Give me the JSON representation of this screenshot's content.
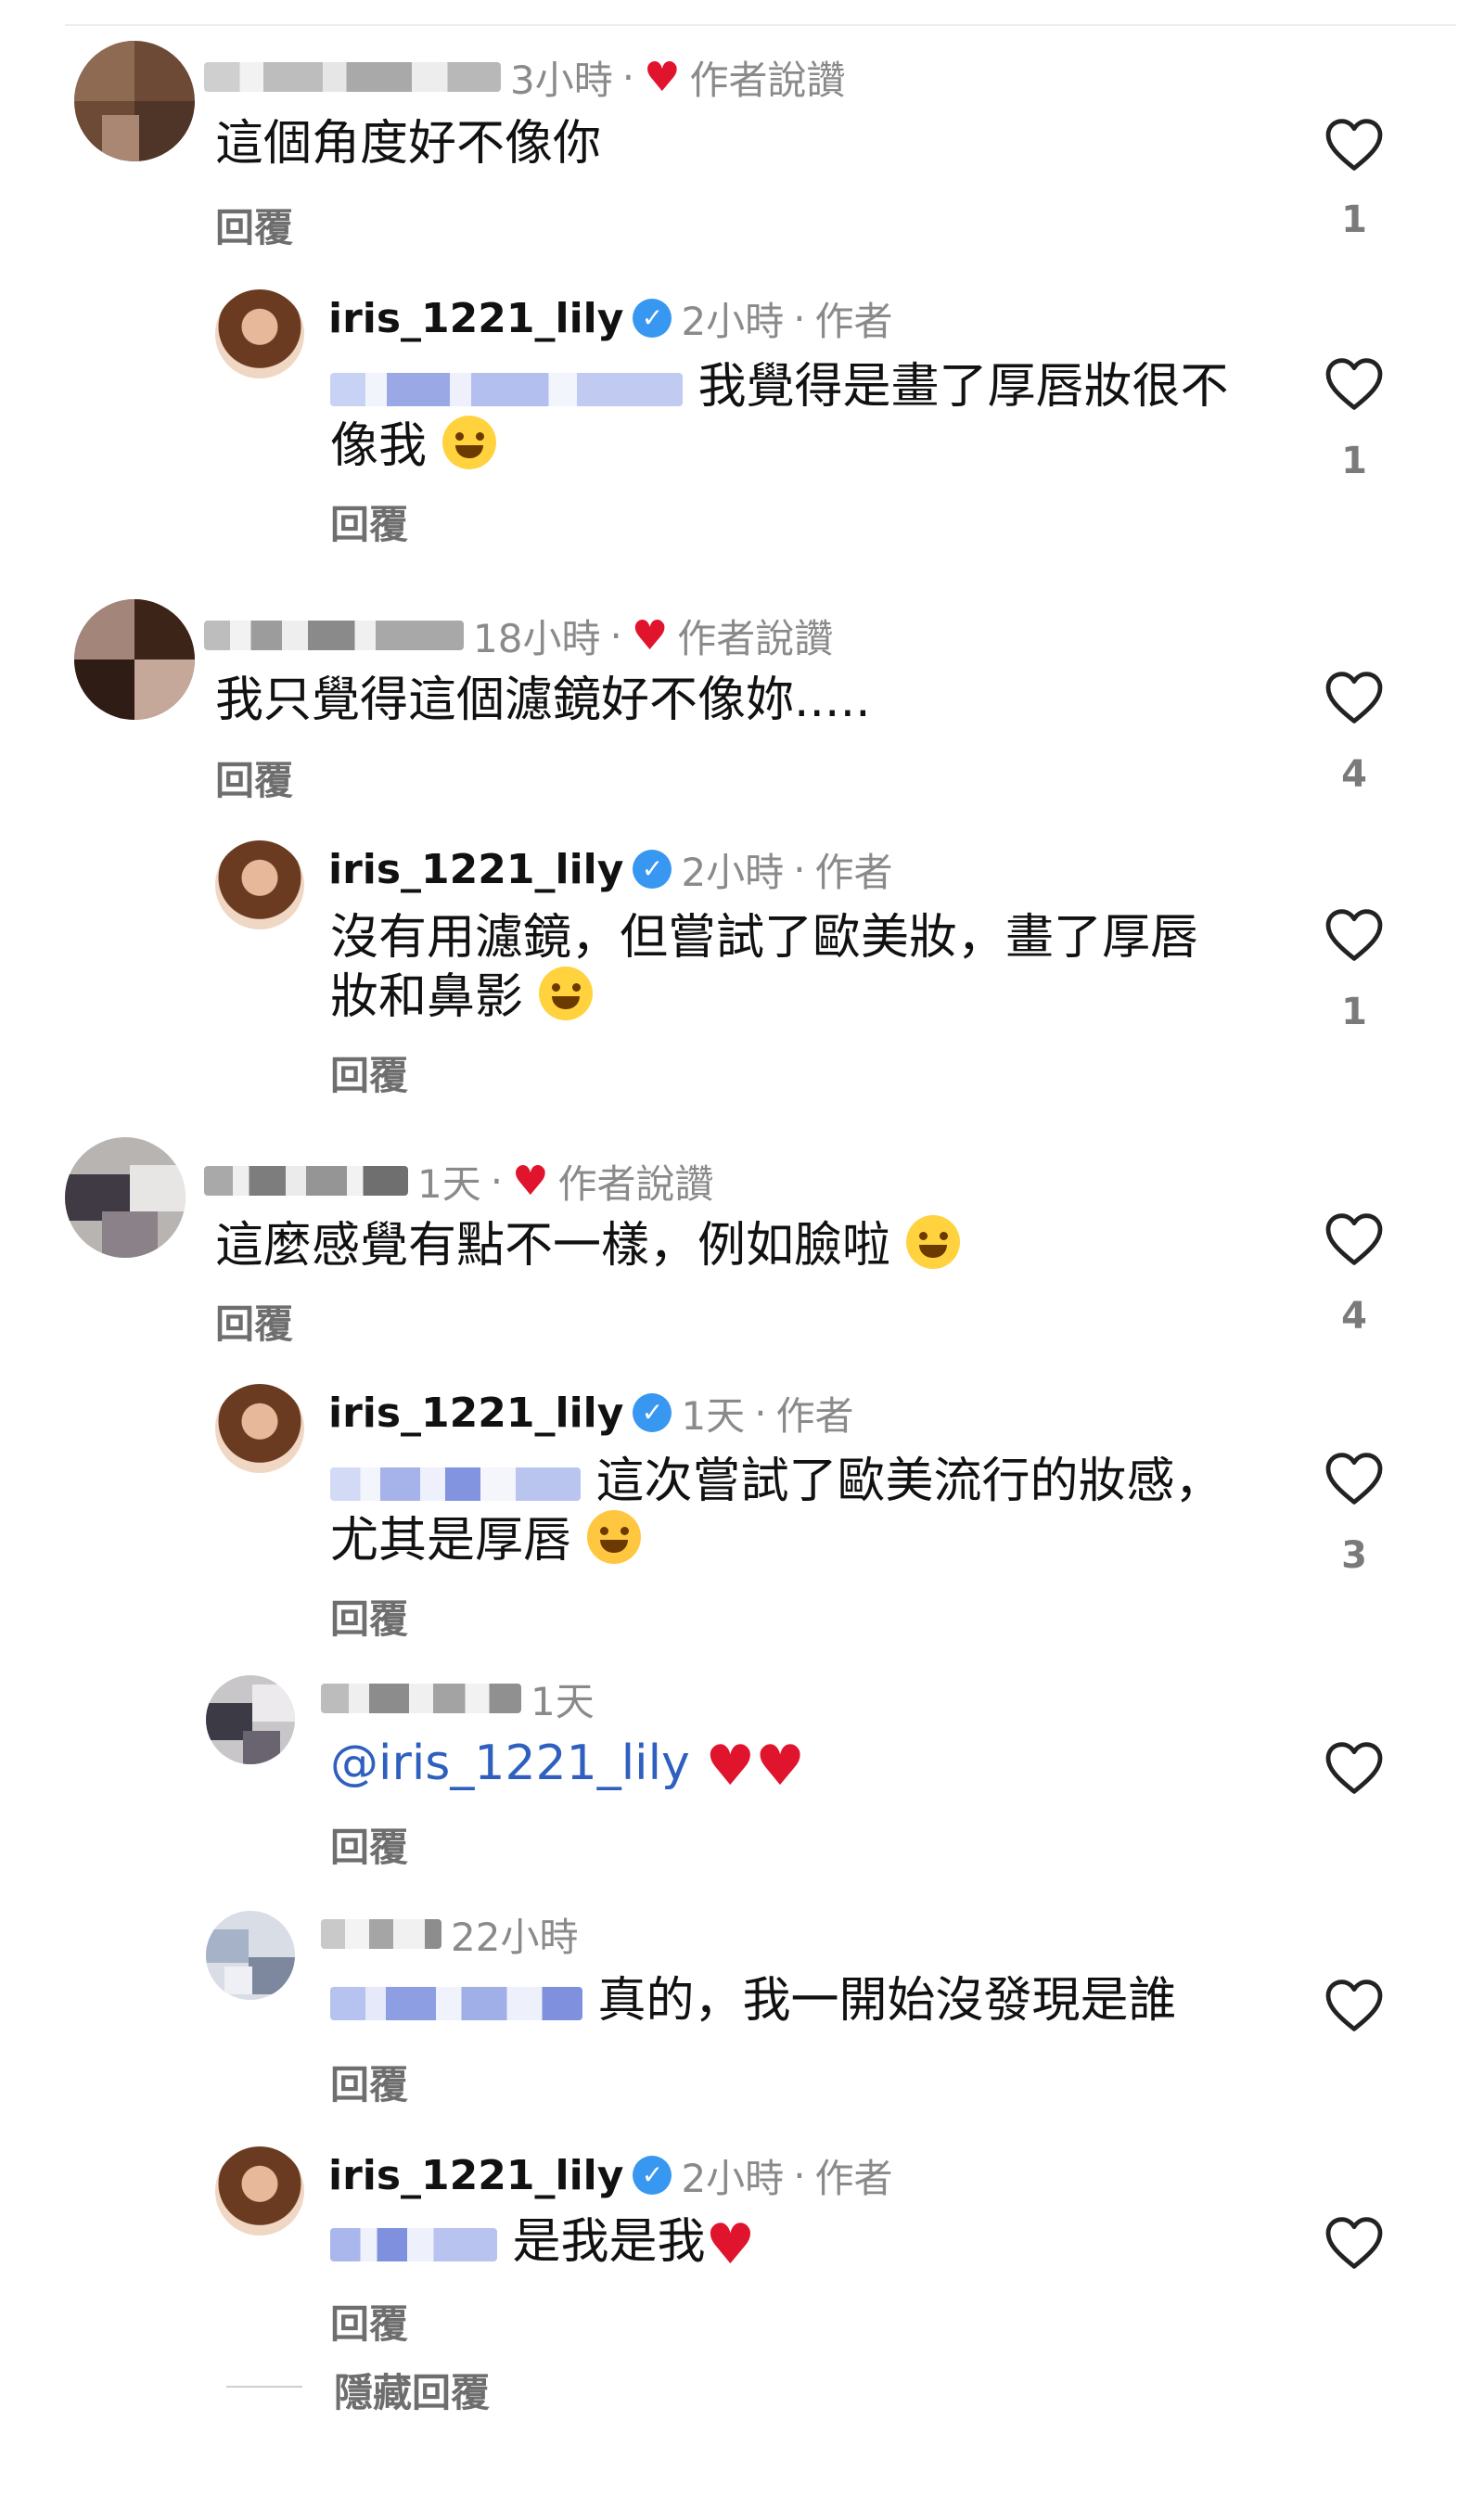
{
  "comments": [
    {
      "time": "3小時",
      "liked_label": "作者說讚",
      "text": "這個角度好不像你",
      "reply": "回覆",
      "likes": "1"
    },
    {
      "author": "iris_1221_lily",
      "time": "2小時",
      "author_tag": "作者",
      "text_line1": "我覺得是畫了厚唇妝很不",
      "text_line2": "像我",
      "reply": "回覆",
      "likes": "1"
    },
    {
      "time": "18小時",
      "liked_label": "作者說讚",
      "text": "我只覺得這個濾鏡好不像妳.....",
      "reply": "回覆",
      "likes": "4"
    },
    {
      "author": "iris_1221_lily",
      "time": "2小時",
      "author_tag": "作者",
      "text_line1": "沒有用濾鏡，但嘗試了歐美妝，畫了厚唇",
      "text_line2": "妝和鼻影",
      "reply": "回覆",
      "likes": "1"
    },
    {
      "time": "1天",
      "liked_label": "作者說讚",
      "text": "這麼感覺有點不一樣，例如臉啦",
      "reply": "回覆",
      "likes": "4"
    },
    {
      "author": "iris_1221_lily",
      "time": "1天",
      "author_tag": "作者",
      "text_line1": "這次嘗試了歐美流行的妝感，",
      "text_line2": "尤其是厚唇",
      "reply": "回覆",
      "likes": "3"
    },
    {
      "time": "1天",
      "text": "@iris_1221_lily",
      "reply": "回覆"
    },
    {
      "time": "22小時",
      "text": "真的，我一開始沒發現是誰",
      "reply": "回覆"
    },
    {
      "author": "iris_1221_lily",
      "time": "2小時",
      "author_tag": "作者",
      "text": "是我是我",
      "reply": "回覆"
    }
  ],
  "hide_replies": "隱藏回覆",
  "separator": "·",
  "verified_mark": "✓",
  "heart_glyph": "♥",
  "colors": {
    "like_red": "#e0142d",
    "mention_blue": "#2f5fbf",
    "verified_blue": "#3897f0"
  },
  "icons": {
    "like": "heart-outline-icon",
    "verified": "verified-badge-icon"
  }
}
